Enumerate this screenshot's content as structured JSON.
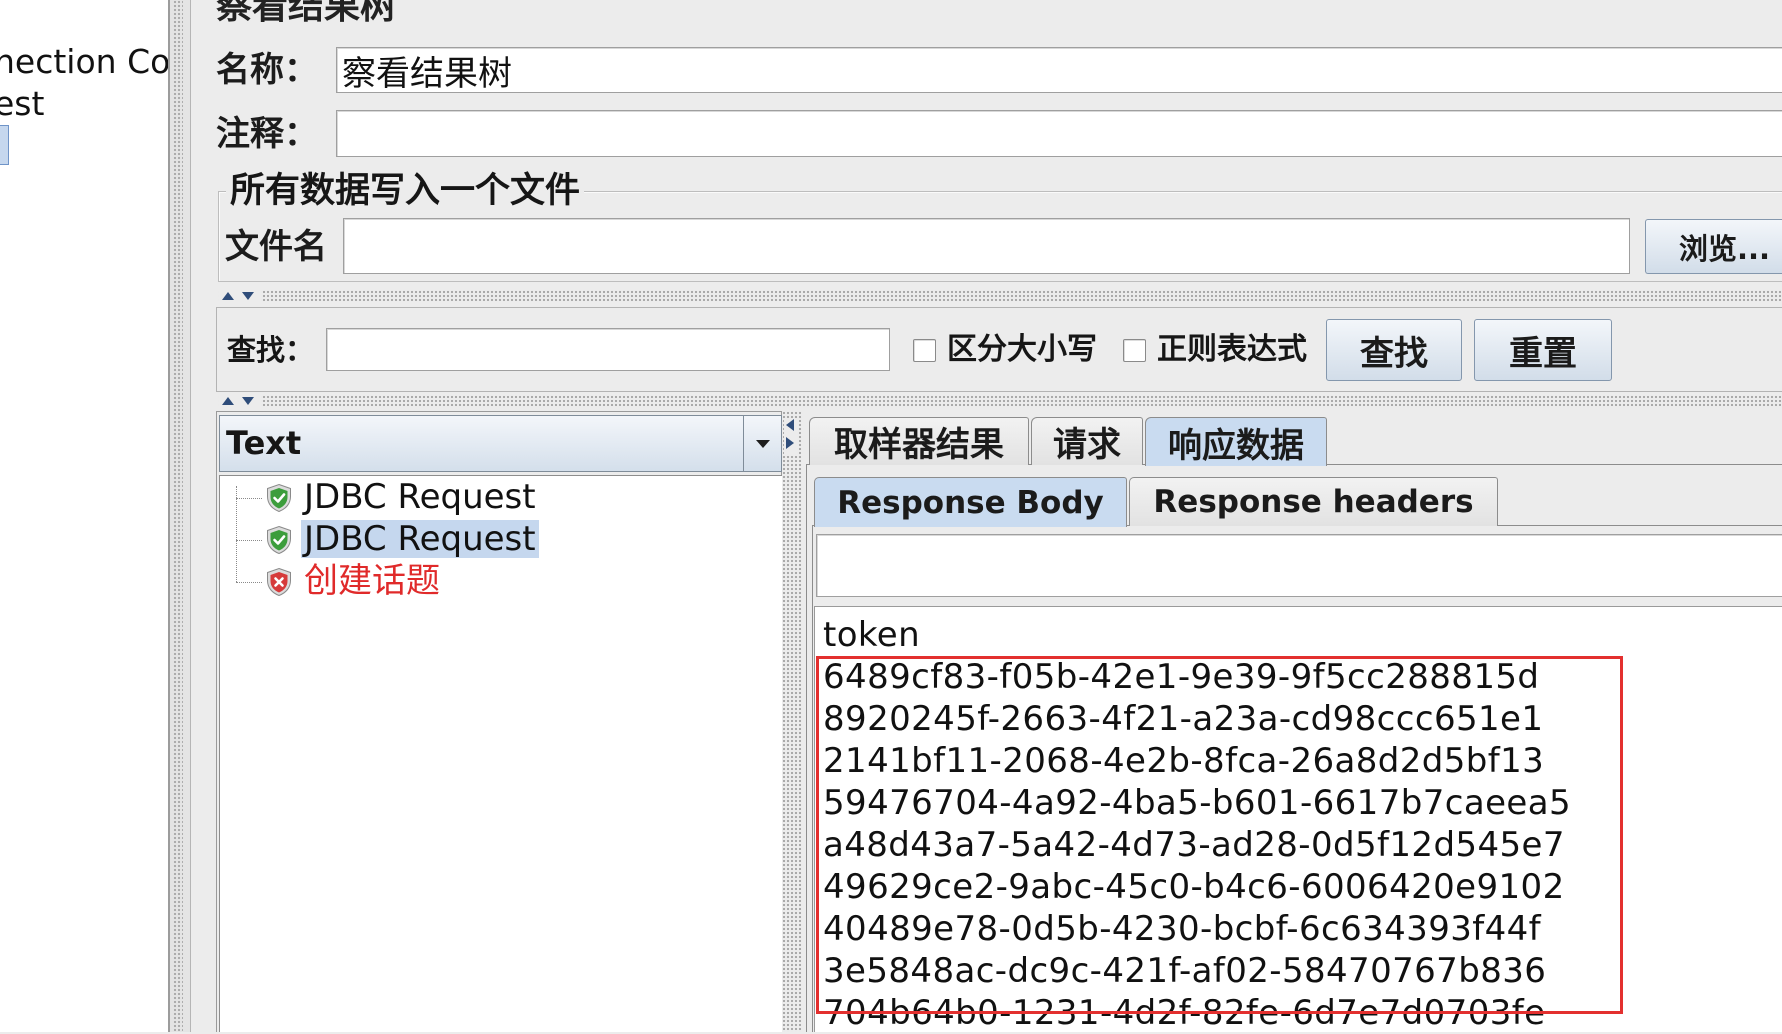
{
  "test_plan_tree": {
    "items": [
      "nection Co",
      "est"
    ]
  },
  "panel_title": "察看结果树",
  "name_field": {
    "label": "名称：",
    "value": "察看结果树"
  },
  "comment_field": {
    "label": "注释：",
    "value": ""
  },
  "file_group": {
    "title": "所有数据写入一个文件",
    "filename_label": "文件名",
    "filename_value": "",
    "browse_button": "浏览..."
  },
  "search": {
    "label": "查找：",
    "value": "",
    "case_sensitive": {
      "label": "区分大小写",
      "checked": false
    },
    "regex": {
      "label": "正则表达式",
      "checked": false
    },
    "find_button": "查找",
    "reset_button": "重置"
  },
  "renderer_select": {
    "selected": "Text"
  },
  "results_tree": {
    "items": [
      {
        "label": "JDBC Request",
        "status": "success",
        "icon": "shield-check-icon",
        "selected": false
      },
      {
        "label": "JDBC Request",
        "status": "success",
        "icon": "shield-check-icon",
        "selected": true
      },
      {
        "label": "创建话题",
        "status": "error",
        "icon": "shield-error-icon",
        "selected": false
      }
    ]
  },
  "result_tabs": [
    {
      "label": "取样器结果",
      "selected": false
    },
    {
      "label": "请求",
      "selected": false
    },
    {
      "label": "响应数据",
      "selected": true
    }
  ],
  "response_tabs": [
    {
      "label": "Response Body",
      "selected": true
    },
    {
      "label": "Response headers",
      "selected": false
    }
  ],
  "response_search_value": "",
  "response_body": {
    "lines": [
      "token",
      "6489cf83-f05b-42e1-9e39-9f5cc288815d",
      "8920245f-2663-4f21-a23a-cd98ccc651e1",
      "2141bf11-2068-4e2b-8fca-26a8d2d5bf13",
      "59476704-4a92-4ba5-b601-6617b7caeea5",
      "a48d43a7-5a42-4d73-ad28-0d5f12d545e7",
      "49629ce2-9abc-45c0-b4c6-6006420e9102",
      "40489e78-0d5b-4230-bcbf-6c634393f44f",
      "3e5848ac-dc9c-421f-af02-58470767b836",
      "704b64b0-1231-4d2f-82fe-6d7e7d0703fe"
    ]
  },
  "colors": {
    "panel_bg": "#ececec",
    "selection_bg": "#c5d7ee",
    "tab_selected_bg": "#c9dbf0",
    "error_text": "#e02a2a",
    "highlight_box": "#e3302f"
  }
}
